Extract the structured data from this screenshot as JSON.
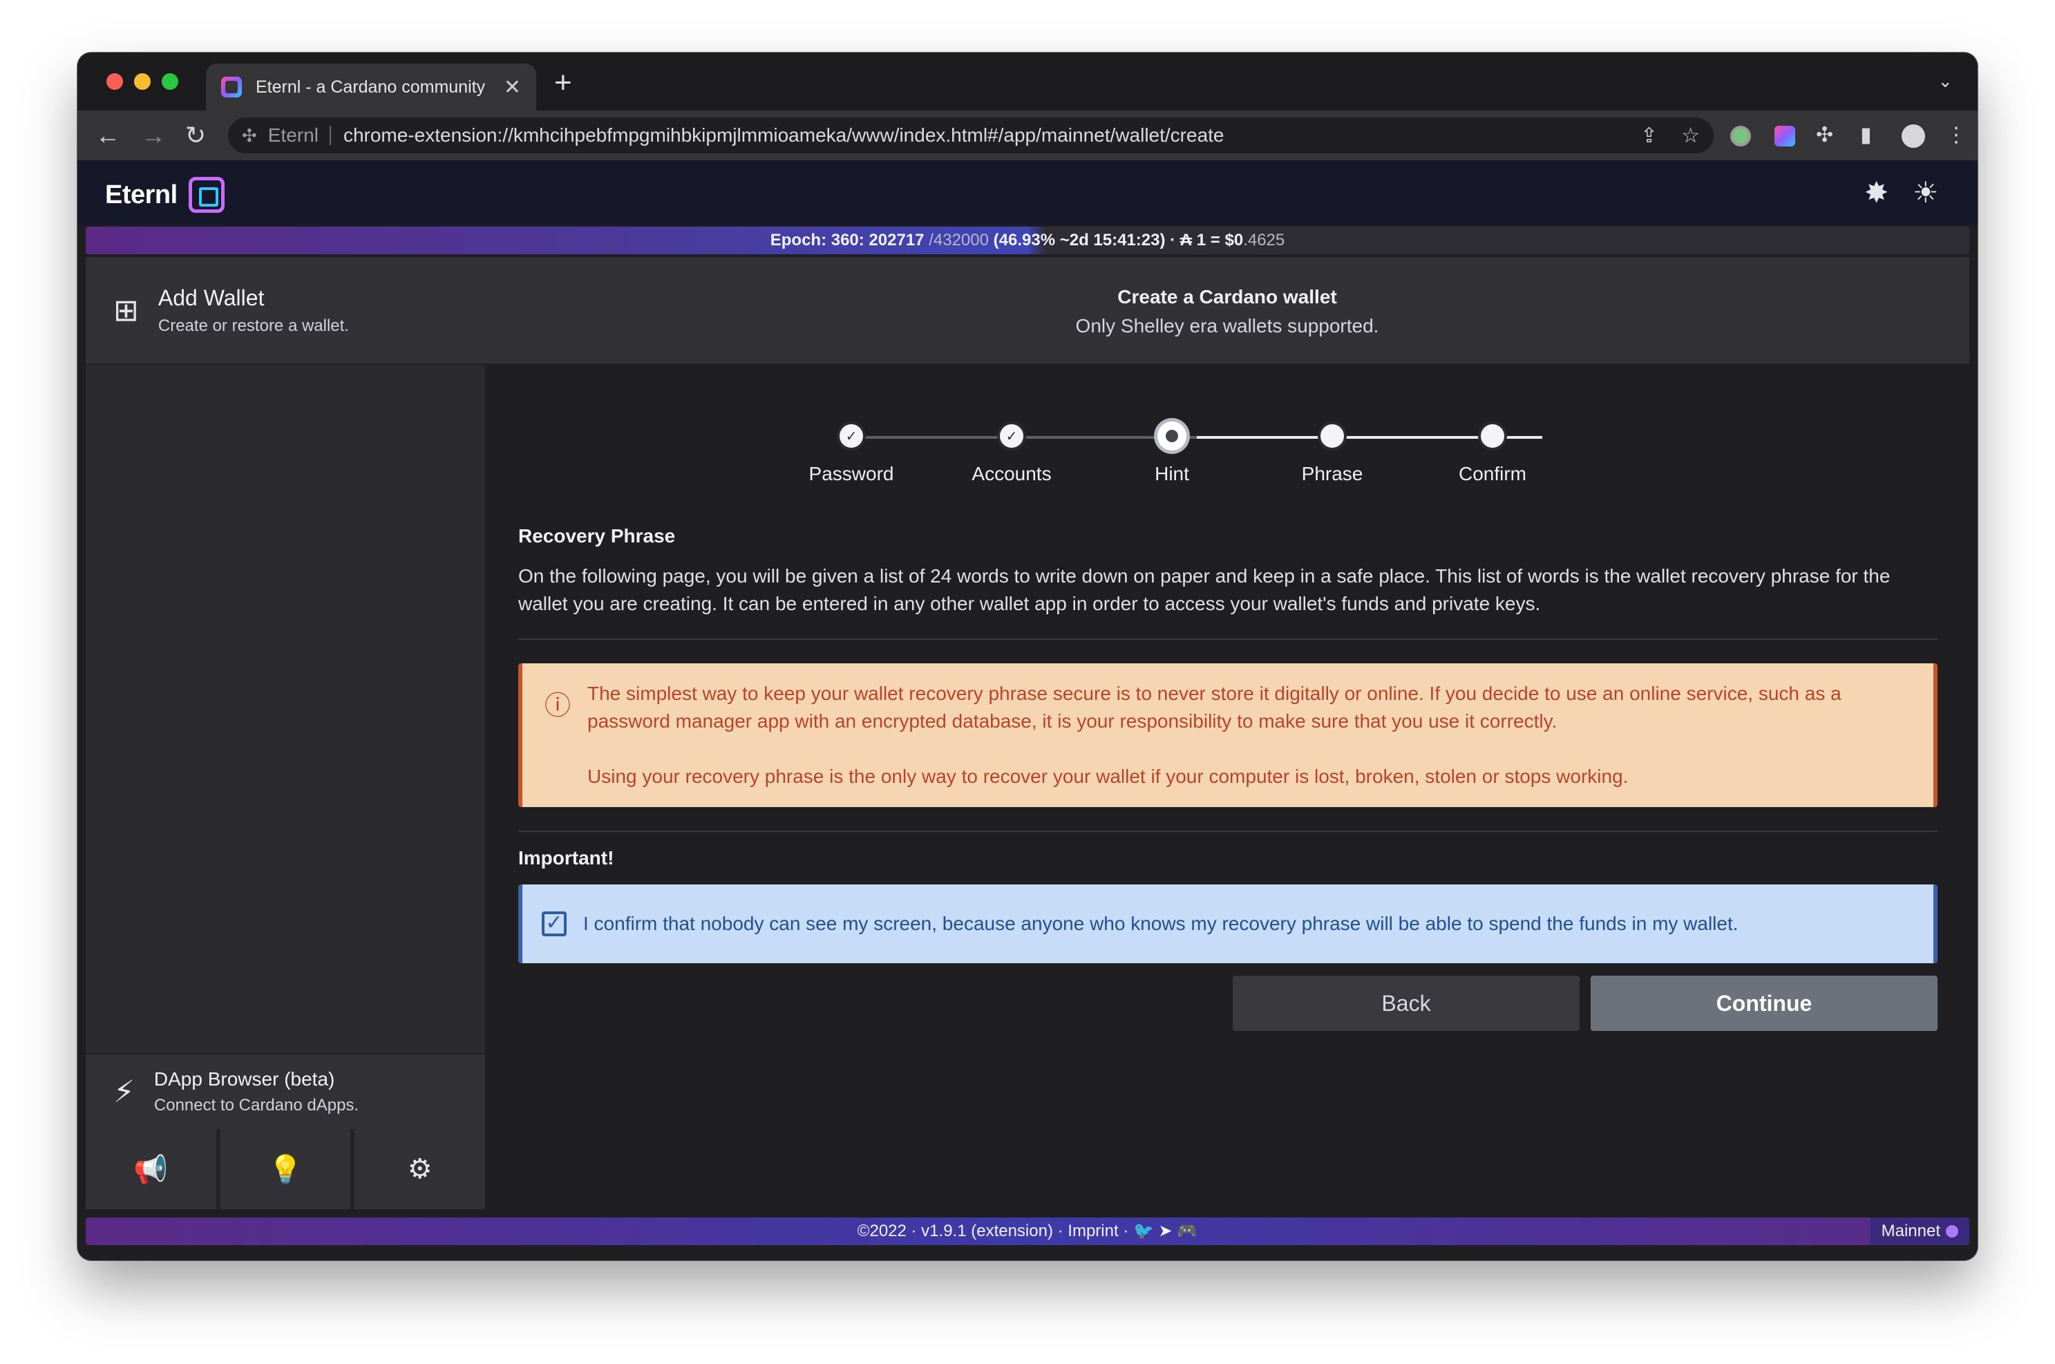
{
  "browser": {
    "tab_title": "Eternl - a Cardano community",
    "tab_close": "✕",
    "new_tab": "+",
    "tab_menu": "⌄",
    "back": "←",
    "forward": "→",
    "reload": "↻",
    "site_name": "Eternl",
    "url": "chrome-extension://kmhcihpebfmpgmihbkipmjlmmioameka/www/index.html#/app/mainnet/wallet/create"
  },
  "app": {
    "brand": "Eternl",
    "epoch": {
      "label": "Epoch: 360: 202717",
      "slots": "/432000",
      "progress": "(46.93% ~2d 15:41:23)",
      "price_prefix": "· ₳ 1 = $0",
      "price_suffix": ".4625"
    },
    "sidebar": {
      "title": "Add Wallet",
      "subtitle": "Create or restore a wallet.",
      "dapp_title": "DApp Browser (beta)",
      "dapp_subtitle": "Connect to Cardano dApps."
    },
    "main": {
      "title": "Create a Cardano wallet",
      "subtitle": "Only Shelley era wallets supported."
    },
    "steps": [
      {
        "label": "Password",
        "state": "done"
      },
      {
        "label": "Accounts",
        "state": "done"
      },
      {
        "label": "Hint",
        "state": "active"
      },
      {
        "label": "Phrase",
        "state": "todo"
      },
      {
        "label": "Confirm",
        "state": "todo"
      }
    ],
    "recovery": {
      "title": "Recovery Phrase",
      "text": "On the following page, you will be given a list of 24 words to write down on paper and keep in a safe place. This list of words is the wallet recovery phrase for the wallet you are creating. It can be entered in any other wallet app in order to access your wallet's funds and private keys."
    },
    "warning": {
      "p1": "The simplest way to keep your wallet recovery phrase secure is to never store it digitally or online. If you decide to use an online service, such as a password manager app with an encrypted database, it is your responsibility to make sure that you use it correctly.",
      "p2": "Using your recovery phrase is the only way to recover your wallet if your computer is lost, broken, stolen or stops working."
    },
    "important": {
      "title": "Important!",
      "confirm_text": "I confirm that nobody can see my screen, because anyone who knows my recovery phrase will be able to spend the funds in my wallet.",
      "checked": true
    },
    "buttons": {
      "back": "Back",
      "continue": "Continue"
    },
    "footer": {
      "text": "©2022 · v1.9.1 (extension) · Imprint ·",
      "network": "Mainnet"
    }
  },
  "colors": {
    "warning_bg": "#f6d5b3",
    "warning_text": "#b8452a",
    "confirm_bg": "#c7dcf7",
    "confirm_text": "#22508f",
    "accent_purple": "#5a2a86"
  }
}
